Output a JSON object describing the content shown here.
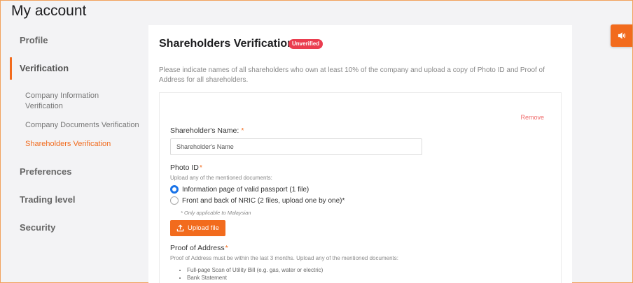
{
  "page": {
    "title": "My account"
  },
  "sidebar": {
    "items": [
      {
        "label": "Profile"
      },
      {
        "label": "Verification"
      },
      {
        "label": "Preferences"
      },
      {
        "label": "Trading level"
      },
      {
        "label": "Security"
      }
    ],
    "sub_items": [
      {
        "label": "Company Information Verification"
      },
      {
        "label": "Company Documents Verification"
      },
      {
        "label": "Shareholders Verification"
      }
    ]
  },
  "main": {
    "title": "Shareholders Verification",
    "status_badge": "Unverified",
    "intro": "Please indicate names of all shareholders who own at least 10% of the company and upload a copy of Photo ID and Proof of Address for all shareholders.",
    "remove_label": "Remove",
    "name_label": "Shareholder's Name:",
    "required_mark": "*",
    "name_placeholder": "Shareholder's Name",
    "photo_id_label": "Photo ID",
    "photo_id_hint": "Upload any of the mentioned documents:",
    "photo_id_options": [
      {
        "label": "Information page of valid passport (1 file)",
        "selected": true
      },
      {
        "label": "Front and back of NRIC (2 files, upload one by one)*",
        "selected": false
      }
    ],
    "nric_note": "* Only applicable to Malaysian",
    "upload_label": "Upload file",
    "poa_label": "Proof of Address",
    "poa_hint": "Proof of Address must be within the last 3 months. Upload any of the mentioned documents:",
    "poa_docs": [
      "Full-page Scan of Utility Bill (e.g. gas, water or electric)",
      "Bank Statement"
    ]
  },
  "float_button": {
    "icon": "speaker-icon"
  },
  "colors": {
    "accent": "#f26b1d",
    "badge": "#ea3d4f",
    "radio": "#1a73e8"
  }
}
